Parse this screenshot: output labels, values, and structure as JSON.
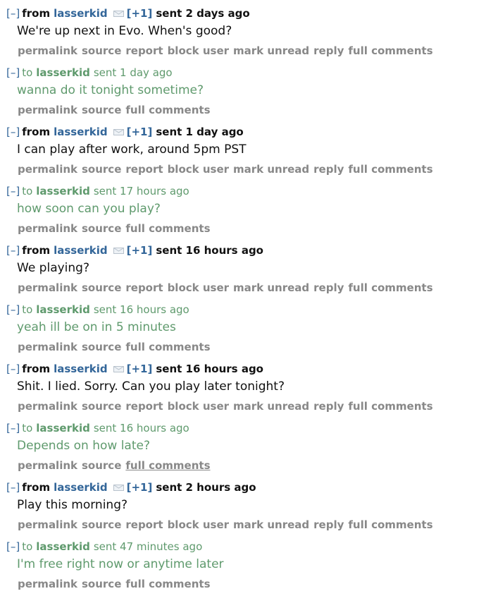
{
  "messages": [
    {
      "direction": "from",
      "word": "from",
      "user": "lasserkid",
      "karma": "[+1]",
      "sent": "sent 2 days ago",
      "body": "We're up next in Evo. When's good?"
    },
    {
      "direction": "to",
      "word": "to",
      "user": "lasserkid",
      "sent": "sent 1 day ago",
      "body": "wanna do it tonight sometime?"
    },
    {
      "direction": "from",
      "word": "from",
      "user": "lasserkid",
      "karma": "[+1]",
      "sent": "sent 1 day ago",
      "body": "I can play after work, around 5pm PST"
    },
    {
      "direction": "to",
      "word": "to",
      "user": "lasserkid",
      "sent": "sent 17 hours ago",
      "body": "how soon can you play?"
    },
    {
      "direction": "from",
      "word": "from",
      "user": "lasserkid",
      "karma": "[+1]",
      "sent": "sent 16 hours ago",
      "body": "We playing?"
    },
    {
      "direction": "to",
      "word": "to",
      "user": "lasserkid",
      "sent": "sent 16 hours ago",
      "body": "yeah ill be on in 5 minutes"
    },
    {
      "direction": "from",
      "word": "from",
      "user": "lasserkid",
      "karma": "[+1]",
      "sent": "sent 16 hours ago",
      "body": "Shit. I lied. Sorry. Can you play later tonight?"
    },
    {
      "direction": "to",
      "word": "to",
      "user": "lasserkid",
      "sent": "sent 16 hours ago",
      "body": "Depends on how late?"
    },
    {
      "direction": "from",
      "word": "from",
      "user": "lasserkid",
      "karma": "[+1]",
      "sent": "sent 2 hours ago",
      "body": "Play this morning?"
    },
    {
      "direction": "to",
      "word": "to",
      "user": "lasserkid",
      "sent": "sent 47 minutes ago",
      "body": "I'm free right now or anytime later"
    }
  ],
  "labels": {
    "toggle": "[–]",
    "permalink": "permalink",
    "source": "source",
    "report": "report",
    "block_user": "block user",
    "mark_unread": "mark unread",
    "reply": "reply",
    "full_comments": "full comments"
  },
  "icons": {
    "mail": "mail-envelope-icon"
  },
  "colors": {
    "link": "#336699",
    "sent_text": "#5f9a6d",
    "action": "#888888",
    "text": "#111111"
  }
}
